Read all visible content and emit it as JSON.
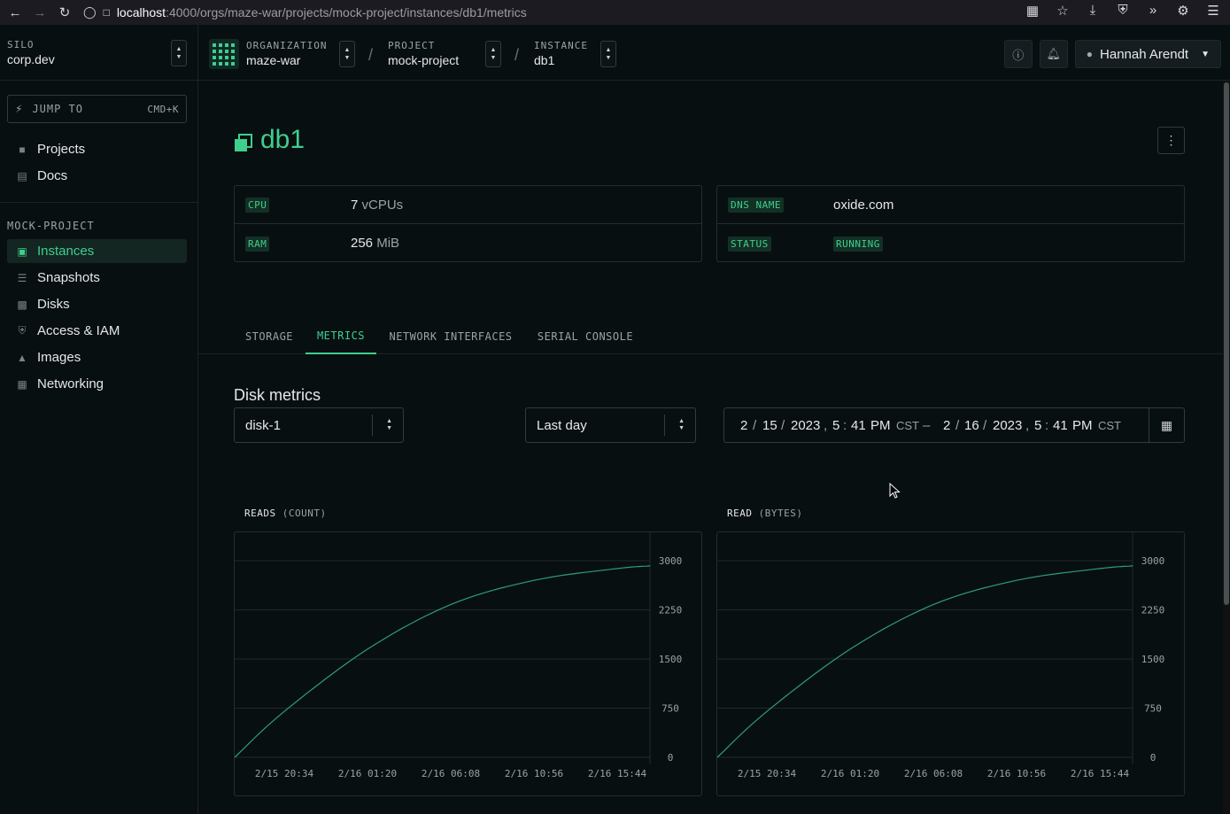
{
  "browser": {
    "url_host": "localhost",
    "url_rest": ":4000/orgs/maze-war/projects/mock-project/instances/db1/metrics"
  },
  "topbar": {
    "silo_label": "SILO",
    "silo_value": "corp.dev",
    "org_label": "ORGANIZATION",
    "org_value": "maze-war",
    "project_label": "PROJECT",
    "project_value": "mock-project",
    "instance_label": "INSTANCE",
    "instance_value": "db1",
    "user_name": "Hannah Arendt"
  },
  "sidebar": {
    "jump_label": "JUMP TO",
    "jump_shortcut": "CMD+K",
    "top_items": [
      {
        "label": "Projects",
        "icon": "folder-icon"
      },
      {
        "label": "Docs",
        "icon": "document-icon"
      }
    ],
    "section_label": "MOCK-PROJECT",
    "project_items": [
      {
        "label": "Instances",
        "icon": "instances-icon",
        "active": true
      },
      {
        "label": "Snapshots",
        "icon": "snapshots-icon"
      },
      {
        "label": "Disks",
        "icon": "disk-icon"
      },
      {
        "label": "Access & IAM",
        "icon": "shield-icon"
      },
      {
        "label": "Images",
        "icon": "images-icon"
      },
      {
        "label": "Networking",
        "icon": "networking-icon"
      }
    ]
  },
  "instance": {
    "name": "db1",
    "cpu_key": "CPU",
    "cpu_value": "7",
    "cpu_unit": "vCPUs",
    "ram_key": "RAM",
    "ram_value": "256",
    "ram_unit": "MiB",
    "dns_key": "DNS NAME",
    "dns_value": "oxide.com",
    "status_key": "STATUS",
    "status_value": "RUNNING"
  },
  "tabs": [
    {
      "label": "STORAGE"
    },
    {
      "label": "METRICS",
      "active": true
    },
    {
      "label": "NETWORK INTERFACES"
    },
    {
      "label": "SERIAL CONSOLE"
    }
  ],
  "metrics": {
    "section_title": "Disk metrics",
    "disk_select": "disk-1",
    "range_select": "Last day",
    "start": {
      "month": "2",
      "day": "15",
      "year": "2023",
      "hour": "5",
      "minute": "41",
      "ampm": "PM",
      "tz": "CST"
    },
    "end": {
      "month": "2",
      "day": "16",
      "year": "2023",
      "hour": "5",
      "minute": "41",
      "ampm": "PM",
      "tz": "CST"
    }
  },
  "chart_data": [
    {
      "type": "line",
      "title": "READS",
      "subtitle": "(COUNT)",
      "x_ticks": [
        "2/15 20:34",
        "2/16 01:20",
        "2/16 06:08",
        "2/16 10:56",
        "2/16 15:44"
      ],
      "y_ticks": [
        "3000",
        "2250",
        "1500",
        "750",
        "0"
      ],
      "ylim": [
        0,
        3000
      ],
      "series": [
        {
          "x": [
            "2/15 17:41",
            "2/15 20:34",
            "2/16 01:20",
            "2/16 06:08",
            "2/16 10:56",
            "2/16 15:44",
            "2/16 17:41"
          ],
          "values": [
            0,
            700,
            1650,
            2330,
            2700,
            2880,
            2920
          ]
        }
      ],
      "color": "#2e9e72",
      "grid": true
    },
    {
      "type": "line",
      "title": "READ",
      "subtitle": "(BYTES)",
      "x_ticks": [
        "2/15 20:34",
        "2/16 01:20",
        "2/16 06:08",
        "2/16 10:56",
        "2/16 15:44"
      ],
      "y_ticks": [
        "3000",
        "2250",
        "1500",
        "750",
        "0"
      ],
      "ylim": [
        0,
        3000
      ],
      "series": [
        {
          "x": [
            "2/15 17:41",
            "2/15 20:34",
            "2/16 01:20",
            "2/16 06:08",
            "2/16 10:56",
            "2/16 15:44",
            "2/16 17:41"
          ],
          "values": [
            0,
            700,
            1650,
            2330,
            2700,
            2880,
            2920
          ]
        }
      ],
      "color": "#2e9e72",
      "grid": true
    }
  ]
}
